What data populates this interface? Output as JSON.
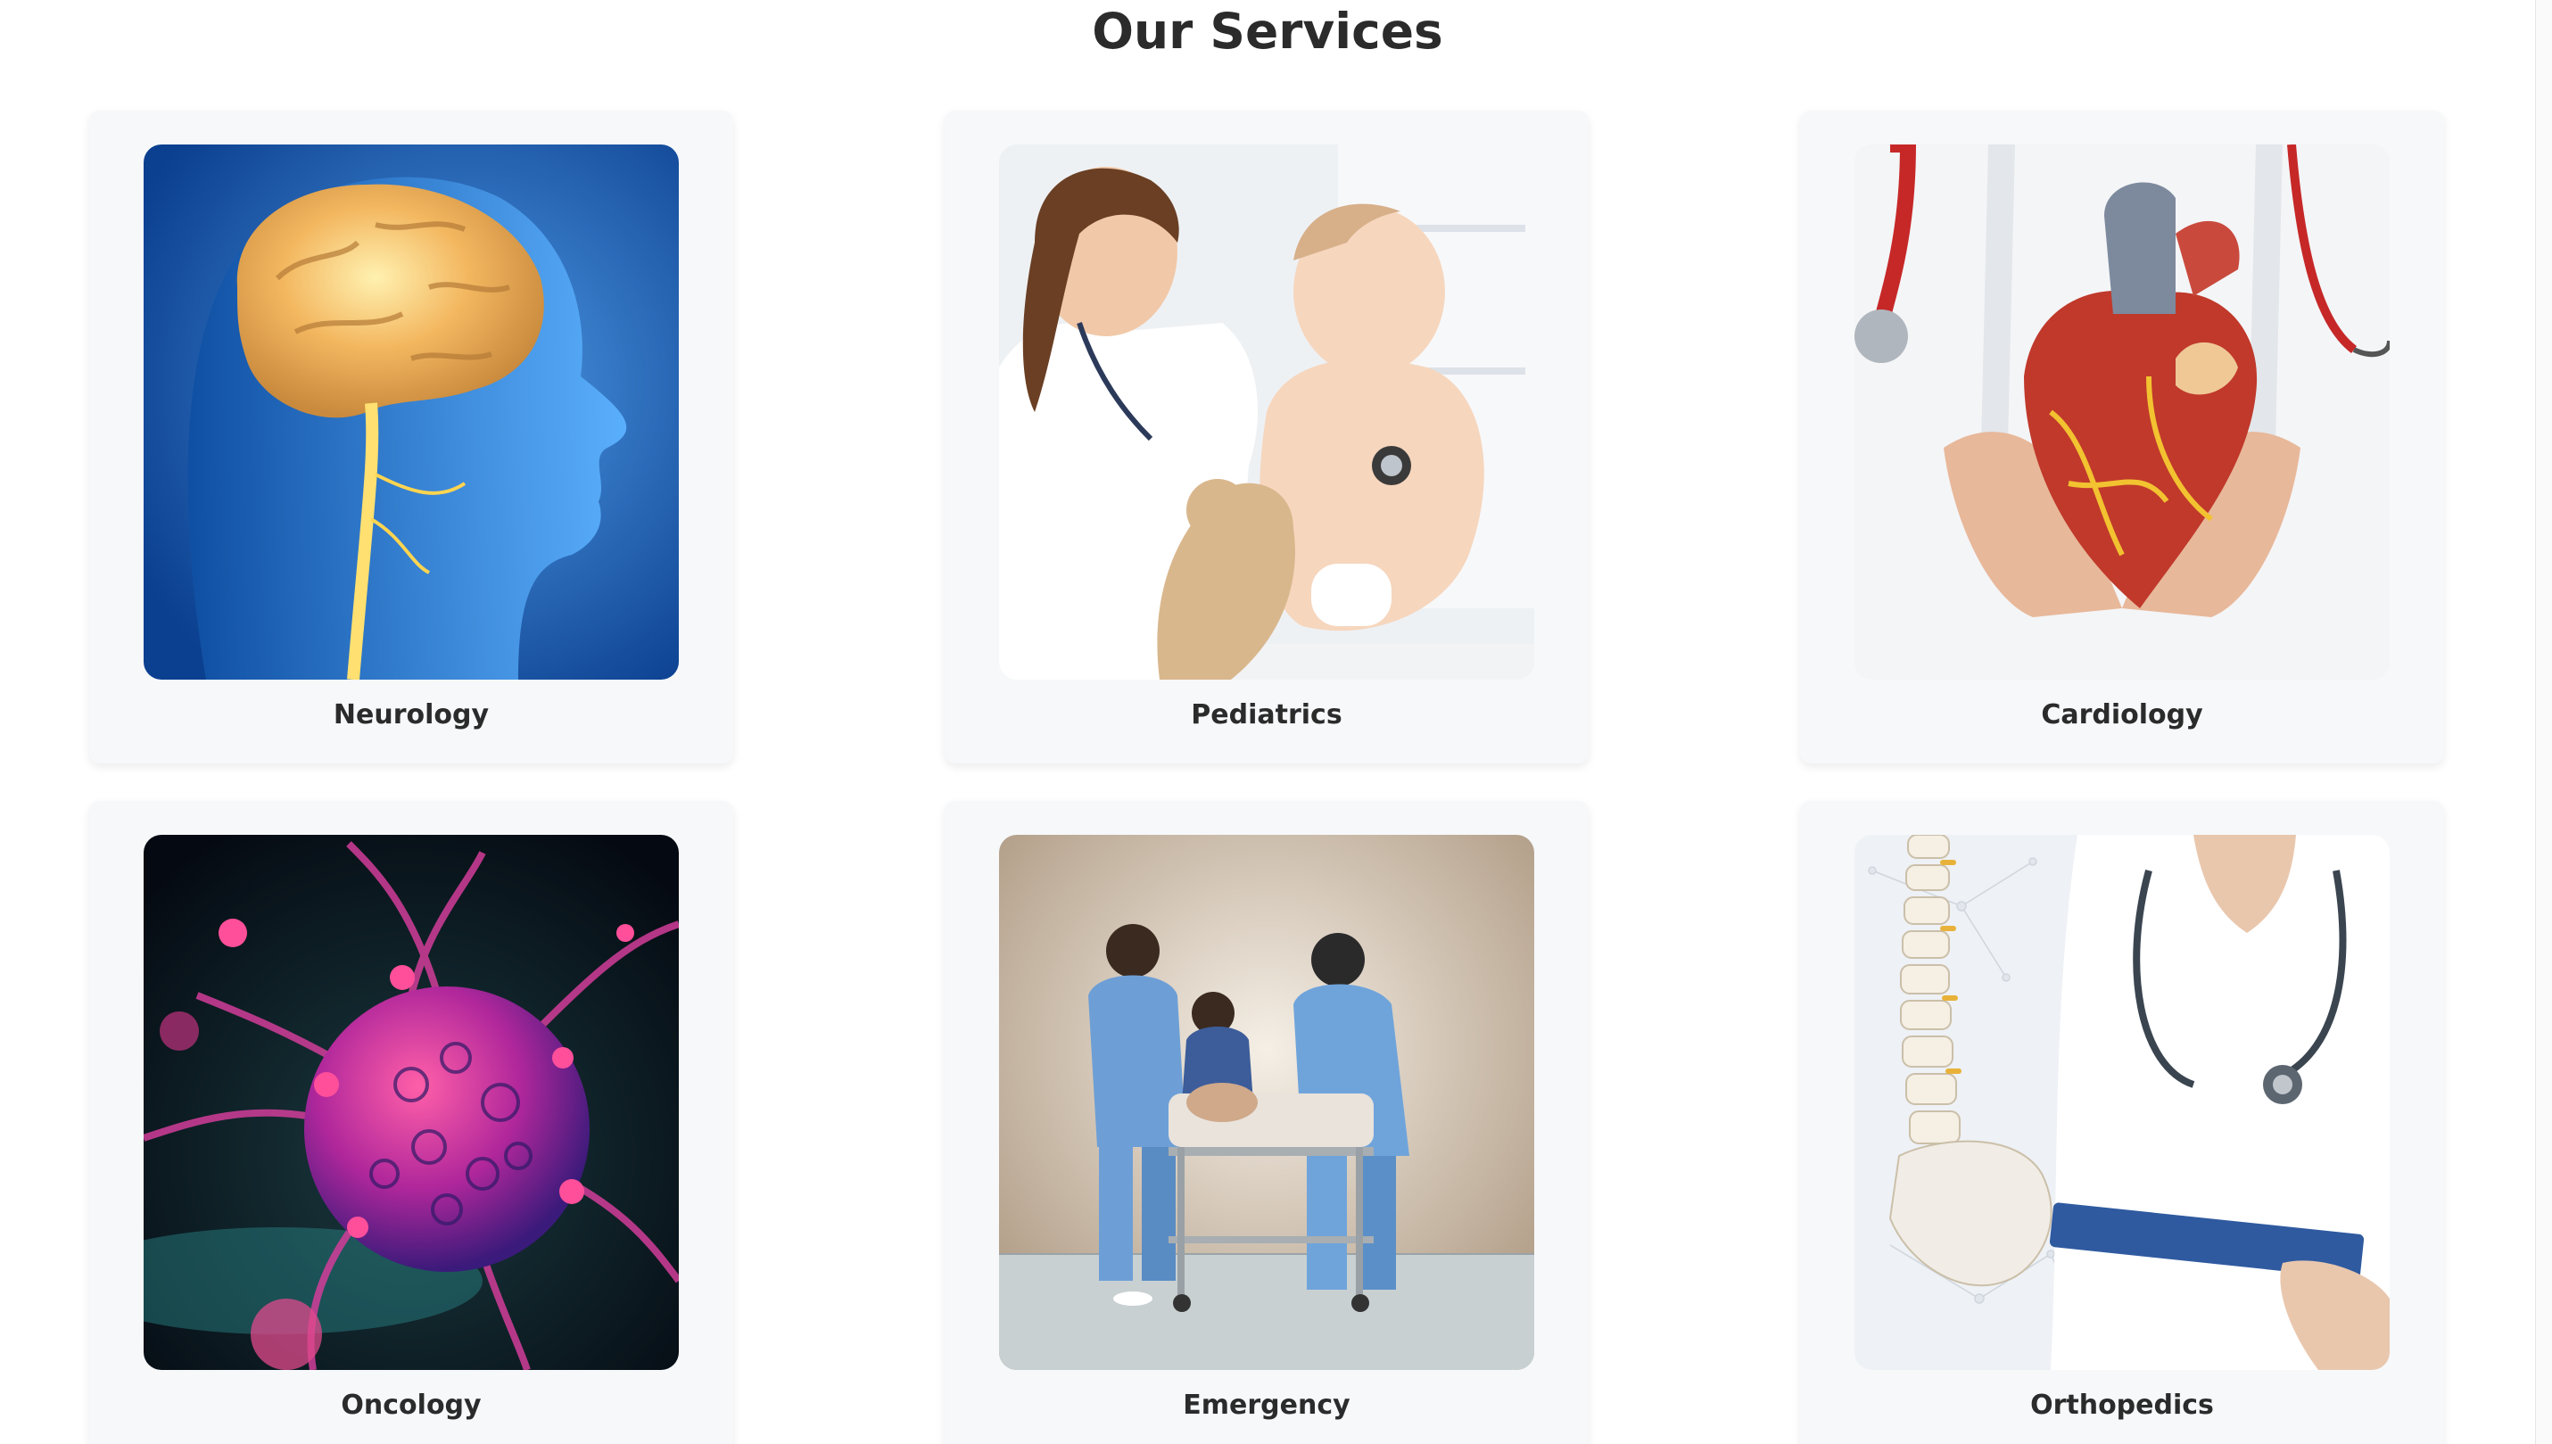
{
  "header": {
    "title": "Our Services"
  },
  "services": [
    {
      "label": "Neurology",
      "image": "brain-head-illustration"
    },
    {
      "label": "Pediatrics",
      "image": "doctor-examining-baby-photo"
    },
    {
      "label": "Cardiology",
      "image": "doctor-holding-heart-model-photo"
    },
    {
      "label": "Oncology",
      "image": "cancer-cell-illustration"
    },
    {
      "label": "Emergency",
      "image": "medical-team-with-stretcher-photo"
    },
    {
      "label": "Orthopedics",
      "image": "doctor-with-spine-model-photo"
    }
  ],
  "colors": {
    "card_background": "#f6f8fa",
    "title_text": "#2b2b2b",
    "page_background": "#ffffff"
  }
}
